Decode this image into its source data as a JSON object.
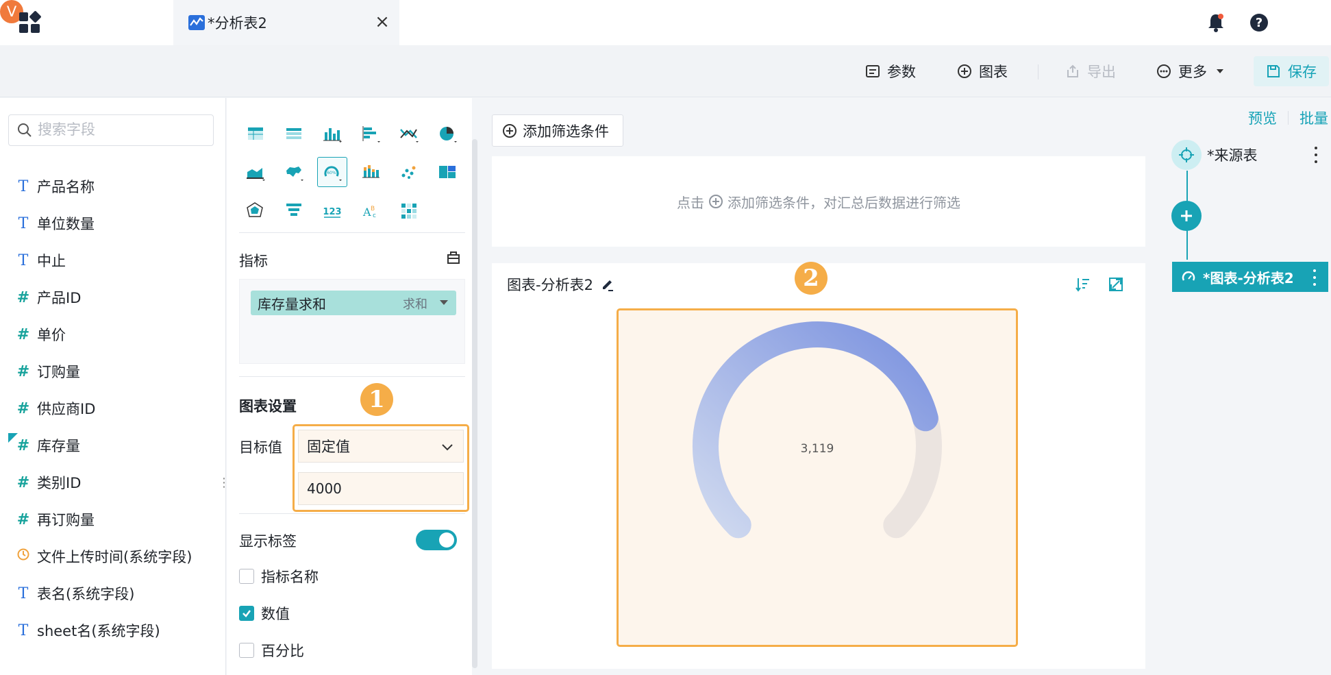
{
  "tab": {
    "label": "*分析表2",
    "close": "×"
  },
  "user": {
    "avatar_letter": "V"
  },
  "toolbar": {
    "params": "参数",
    "chart": "图表",
    "export": "导出",
    "more": "更多",
    "save": "保存"
  },
  "fields": {
    "search_placeholder": "搜索字段",
    "items": [
      {
        "type": "T",
        "label": "产品名称"
      },
      {
        "type": "T",
        "label": "单位数量"
      },
      {
        "type": "T",
        "label": "中止"
      },
      {
        "type": "#",
        "label": "产品ID"
      },
      {
        "type": "#",
        "label": "单价"
      },
      {
        "type": "#",
        "label": "订购量"
      },
      {
        "type": "#",
        "label": "供应商ID"
      },
      {
        "type": "#",
        "label": "库存量"
      },
      {
        "type": "#",
        "label": "类别ID"
      },
      {
        "type": "#",
        "label": "再订购量"
      },
      {
        "type": "clock",
        "label": "文件上传时间(系统字段)"
      },
      {
        "type": "T",
        "label": "表名(系统字段)"
      },
      {
        "type": "T",
        "label": "sheet名(系统字段)"
      }
    ]
  },
  "config": {
    "metric_title": "指标",
    "metric_pill": {
      "label": "库存量求和",
      "agg": "求和"
    },
    "chart_settings_title": "图表设置",
    "target_label": "目标值",
    "target_mode": "固定值",
    "target_value": "4000",
    "show_label": "显示标签",
    "checkboxes": [
      {
        "label": "指标名称",
        "checked": false
      },
      {
        "label": "数值",
        "checked": true
      },
      {
        "label": "百分比",
        "checked": false
      }
    ],
    "badge1": "1",
    "badge2": "2"
  },
  "main": {
    "filter_button": "添加筛选条件",
    "filter_hint_prefix": "点击",
    "filter_hint_suffix": "添加筛选条件，对汇总后数据进行筛选",
    "chart_title": "图表-分析表2"
  },
  "chart_data": {
    "type": "gauge",
    "value": 3119,
    "target": 4000,
    "value_label": "3,119",
    "colors": {
      "start": "#cfd9ef",
      "end": "#7b92df",
      "track": "#ebe4e0"
    }
  },
  "flow": {
    "preview": "预览",
    "batch": "批量",
    "source_node": "*来源表",
    "chart_node": "*图表-分析表2"
  }
}
